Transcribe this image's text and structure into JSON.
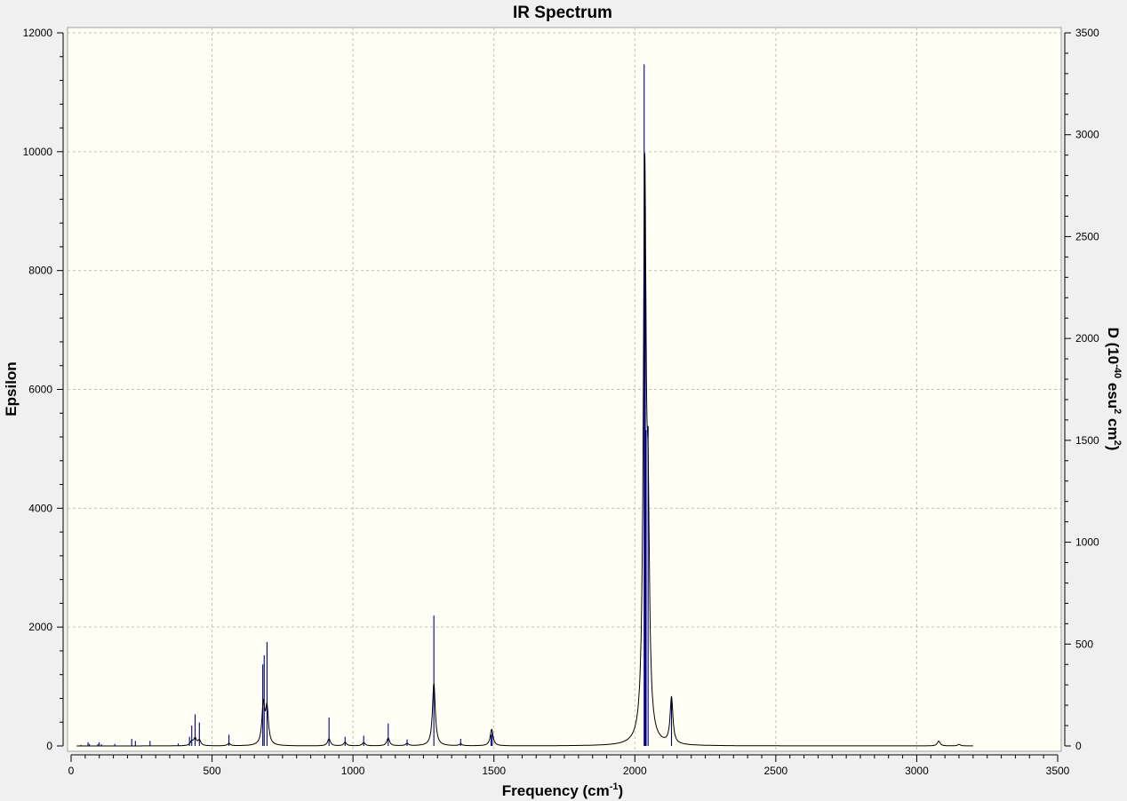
{
  "chart_data": {
    "type": "line",
    "title": "IR Spectrum",
    "xlabel_main": "Frequency (cm",
    "xlabel_sup": "-1",
    "xlabel_end": ")",
    "ylabel": "Epsilon",
    "y2label_parts": [
      "D (10",
      "-40",
      " esu",
      "2",
      " cm",
      "2",
      ")"
    ],
    "xlim": [
      0,
      3500
    ],
    "ylim": [
      0,
      12000
    ],
    "y2lim": [
      0,
      3500
    ],
    "xticks": [
      "0",
      "500",
      "1000",
      "1500",
      "2000",
      "2500",
      "3000",
      "3500"
    ],
    "yticks": [
      "0",
      "2000",
      "4000",
      "6000",
      "8000",
      "10000",
      "12000"
    ],
    "y2ticks": [
      "0",
      "500",
      "1000",
      "1500",
      "2000",
      "2500",
      "3000",
      "3500"
    ],
    "grid": true,
    "spectrum_end_x": 3200,
    "series": [
      {
        "kind": "stick",
        "axis": "right",
        "color": "#000080",
        "x": [
          35,
          60,
          65,
          95,
          100,
          108,
          155,
          215,
          228,
          280,
          380,
          420,
          428,
          440,
          455,
          560,
          680,
          685,
          695,
          915,
          972,
          1038,
          1125,
          1192,
          1287,
          1382,
          1490,
          1494,
          2033,
          2035,
          2037,
          2040,
          2047,
          2130
        ],
        "values": [
          5,
          18,
          10,
          10,
          18,
          8,
          10,
          35,
          25,
          25,
          12,
          45,
          100,
          155,
          115,
          55,
          400,
          445,
          510,
          140,
          45,
          50,
          110,
          32,
          640,
          35,
          55,
          75,
          3345,
          2720,
          2650,
          1550,
          1570,
          235
        ]
      },
      {
        "kind": "envelope",
        "axis": "left",
        "color": "#000000",
        "x": [
          428,
          440,
          455,
          560,
          682,
          695,
          915,
          972,
          1038,
          1125,
          1192,
          1287,
          1382,
          1492,
          2035,
          2047,
          2130,
          3078,
          3150
        ],
        "values": [
          70,
          120,
          90,
          40,
          680,
          600,
          120,
          60,
          55,
          130,
          40,
          1050,
          30,
          280,
          9350,
          3100,
          780,
          80,
          25
        ]
      }
    ]
  }
}
